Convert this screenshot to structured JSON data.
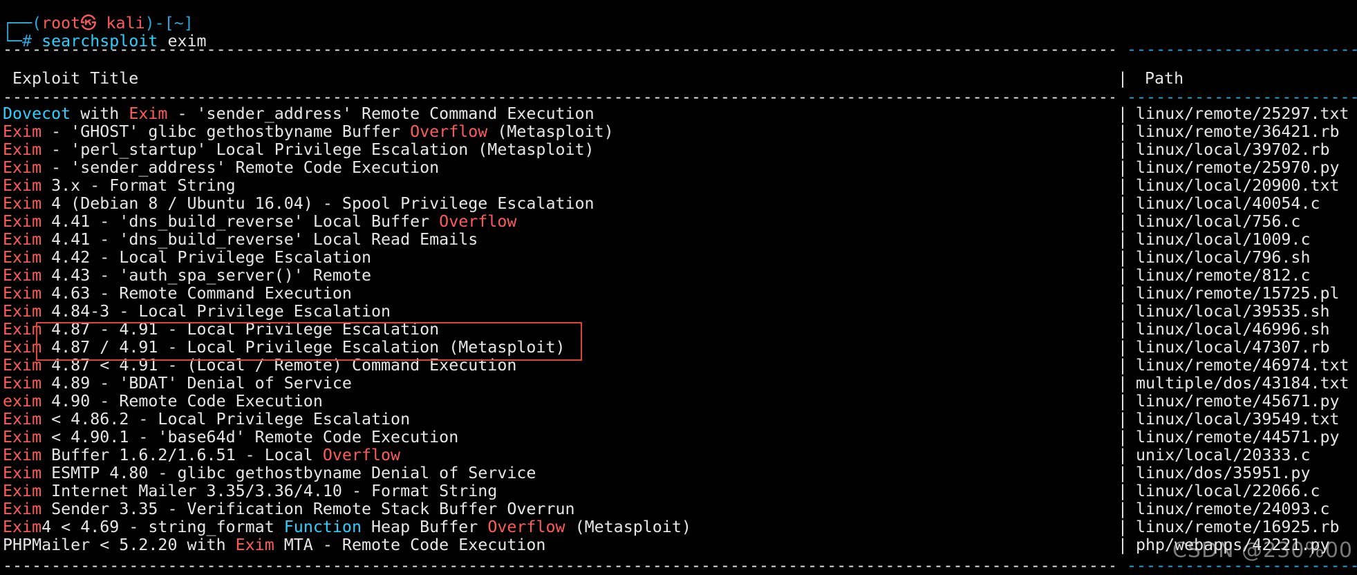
{
  "prompt": {
    "open": "┌──(",
    "user": "root㉿ kali",
    "close": ")-[~]",
    "hash": "└─# ",
    "command": "searchsploit",
    "argument": " exim"
  },
  "table": {
    "header_title": "Exploit Title",
    "header_sep": "|",
    "header_path": "Path",
    "rows": [
      {
        "segments": [
          {
            "t": "Dovecot",
            "c": "blue"
          },
          {
            "t": " with ",
            "c": "w"
          },
          {
            "t": "Exim",
            "c": "r"
          },
          {
            "t": " - 'sender_address' Remote Command Execution",
            "c": "w"
          }
        ],
        "path": "linux/remote/25297.txt"
      },
      {
        "segments": [
          {
            "t": "Exim",
            "c": "r"
          },
          {
            "t": " - 'GHOST' glibc gethostbyname Buffer ",
            "c": "w"
          },
          {
            "t": "Overflow",
            "c": "r"
          },
          {
            "t": " (Metasploit)",
            "c": "w"
          }
        ],
        "path": "linux/remote/36421.rb"
      },
      {
        "segments": [
          {
            "t": "Exim",
            "c": "r"
          },
          {
            "t": " - 'perl_startup' Local Privilege Escalation (Metasploit)",
            "c": "w"
          }
        ],
        "path": "linux/local/39702.rb"
      },
      {
        "segments": [
          {
            "t": "Exim",
            "c": "r"
          },
          {
            "t": " - 'sender_address' Remote Code Execution",
            "c": "w"
          }
        ],
        "path": "linux/remote/25970.py"
      },
      {
        "segments": [
          {
            "t": "Exim",
            "c": "r"
          },
          {
            "t": " 3.x - Format String",
            "c": "w"
          }
        ],
        "path": "linux/local/20900.txt"
      },
      {
        "segments": [
          {
            "t": "Exim",
            "c": "r"
          },
          {
            "t": " 4 (Debian 8 / Ubuntu 16.04) - Spool Privilege Escalation",
            "c": "w"
          }
        ],
        "path": "linux/local/40054.c"
      },
      {
        "segments": [
          {
            "t": "Exim",
            "c": "r"
          },
          {
            "t": " 4.41 - 'dns_build_reverse' Local Buffer ",
            "c": "w"
          },
          {
            "t": "Overflow",
            "c": "r"
          }
        ],
        "path": "linux/local/756.c"
      },
      {
        "segments": [
          {
            "t": "Exim",
            "c": "r"
          },
          {
            "t": " 4.41 - 'dns_build_reverse' Local Read Emails",
            "c": "w"
          }
        ],
        "path": "linux/local/1009.c"
      },
      {
        "segments": [
          {
            "t": "Exim",
            "c": "r"
          },
          {
            "t": " 4.42 - Local Privilege Escalation",
            "c": "w"
          }
        ],
        "path": "linux/local/796.sh"
      },
      {
        "segments": [
          {
            "t": "Exim",
            "c": "r"
          },
          {
            "t": " 4.43 - 'auth_spa_server()' Remote",
            "c": "w"
          }
        ],
        "path": "linux/remote/812.c"
      },
      {
        "segments": [
          {
            "t": "Exim",
            "c": "r"
          },
          {
            "t": " 4.63 - Remote Command Execution",
            "c": "w"
          }
        ],
        "path": "linux/remote/15725.pl"
      },
      {
        "segments": [
          {
            "t": "Exim",
            "c": "r"
          },
          {
            "t": " 4.84-3 - Local Privilege Escalation",
            "c": "w"
          }
        ],
        "path": "linux/local/39535.sh"
      },
      {
        "segments": [
          {
            "t": "Exim",
            "c": "r"
          },
          {
            "t": " 4.87 - 4.91 - Local Privilege Escalation",
            "c": "w"
          }
        ],
        "path": "linux/local/46996.sh"
      },
      {
        "segments": [
          {
            "t": "Exim",
            "c": "r"
          },
          {
            "t": " 4.87 / 4.91 - Local Privilege Escalation (Metasploit)",
            "c": "w"
          }
        ],
        "path": "linux/local/47307.rb"
      },
      {
        "segments": [
          {
            "t": "Exim",
            "c": "r"
          },
          {
            "t": " 4.87 < 4.91 - (Local / Remote) Command Execution",
            "c": "w"
          }
        ],
        "path": "linux/remote/46974.txt"
      },
      {
        "segments": [
          {
            "t": "Exim",
            "c": "r"
          },
          {
            "t": " 4.89 - 'BDAT' Denial of Service",
            "c": "w"
          }
        ],
        "path": "multiple/dos/43184.txt"
      },
      {
        "segments": [
          {
            "t": "exim",
            "c": "r"
          },
          {
            "t": " 4.90 - Remote Code Execution",
            "c": "w"
          }
        ],
        "path": "linux/remote/45671.py"
      },
      {
        "segments": [
          {
            "t": "Exim",
            "c": "r"
          },
          {
            "t": " < 4.86.2 - Local Privilege Escalation",
            "c": "w"
          }
        ],
        "path": "linux/local/39549.txt"
      },
      {
        "segments": [
          {
            "t": "Exim",
            "c": "r"
          },
          {
            "t": " < 4.90.1 - 'base64d' Remote Code Execution",
            "c": "w"
          }
        ],
        "path": "linux/remote/44571.py"
      },
      {
        "segments": [
          {
            "t": "Exim",
            "c": "r"
          },
          {
            "t": " Buffer 1.6.2/1.6.51 - Local ",
            "c": "w"
          },
          {
            "t": "Overflow",
            "c": "r"
          }
        ],
        "path": "unix/local/20333.c"
      },
      {
        "segments": [
          {
            "t": "Exim",
            "c": "r"
          },
          {
            "t": " ESMTP 4.80 - glibc gethostbyname Denial of Service",
            "c": "w"
          }
        ],
        "path": "linux/dos/35951.py"
      },
      {
        "segments": [
          {
            "t": "Exim",
            "c": "r"
          },
          {
            "t": " Internet Mailer 3.35/3.36/4.10 - Format String",
            "c": "w"
          }
        ],
        "path": "linux/local/22066.c"
      },
      {
        "segments": [
          {
            "t": "Exim",
            "c": "r"
          },
          {
            "t": " Sender 3.35 - Verification Remote Stack Buffer Overrun",
            "c": "w"
          }
        ],
        "path": "linux/remote/24093.c"
      },
      {
        "segments": [
          {
            "t": "Exim",
            "c": "r"
          },
          {
            "t": "4 < 4.69 - string_format ",
            "c": "w"
          },
          {
            "t": "Function",
            "c": "blue"
          },
          {
            "t": " Heap Buffer ",
            "c": "w"
          },
          {
            "t": "Overflow",
            "c": "r"
          },
          {
            "t": " (Metasploit)",
            "c": "w"
          }
        ],
        "path": "linux/remote/16925.rb"
      },
      {
        "segments": [
          {
            "t": "PHPMailer < 5.2.20 with ",
            "c": "w"
          },
          {
            "t": "Exim",
            "c": "r"
          },
          {
            "t": " MTA - Remote Code Execution",
            "c": "w"
          }
        ],
        "path": "php/webapps/42221.py"
      }
    ]
  },
  "watermark": "CSDN @230%00",
  "colors": {
    "background": "#000000",
    "text": "#e6e6e6",
    "highlight_red": "#ff5a5a",
    "highlight_blue": "#2bd0ff",
    "prompt_blue": "#2aa7d8",
    "selection_box": "#e0433a"
  }
}
